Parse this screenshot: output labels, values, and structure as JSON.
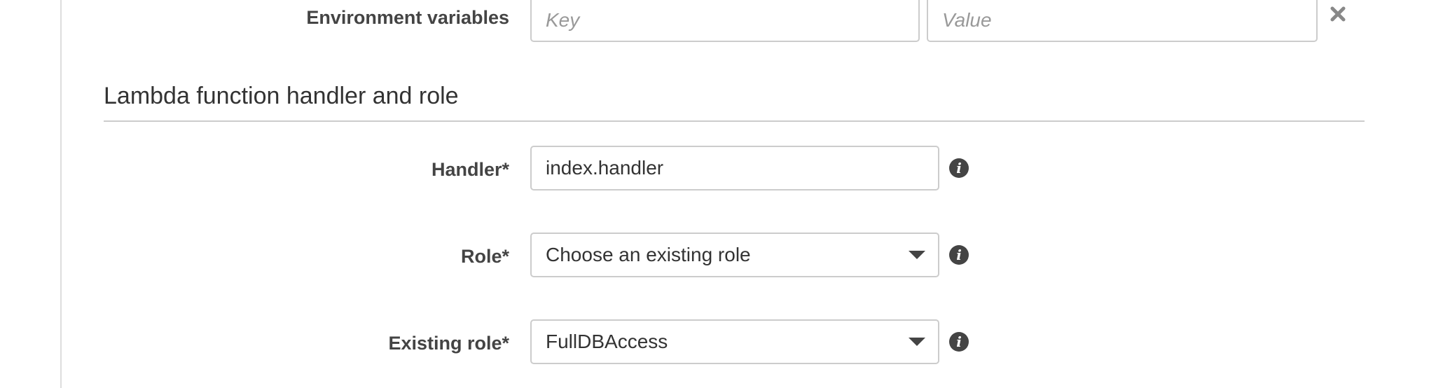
{
  "env_vars": {
    "label": "Environment variables",
    "key_placeholder": "Key",
    "value_placeholder": "Value",
    "remove_icon": "close-icon"
  },
  "section": {
    "title": "Lambda function handler and role"
  },
  "handler": {
    "label": "Handler*",
    "value": "index.handler",
    "info_icon": "info-icon"
  },
  "role": {
    "label": "Role*",
    "selected": "Choose an existing role",
    "info_icon": "info-icon"
  },
  "existing_role": {
    "label": "Existing role*",
    "selected": "FullDBAccess",
    "info_icon": "info-icon"
  },
  "colors": {
    "border": "#cccccc",
    "text": "#333333",
    "label": "#444444",
    "placeholder": "#999999",
    "icon": "#444444"
  }
}
